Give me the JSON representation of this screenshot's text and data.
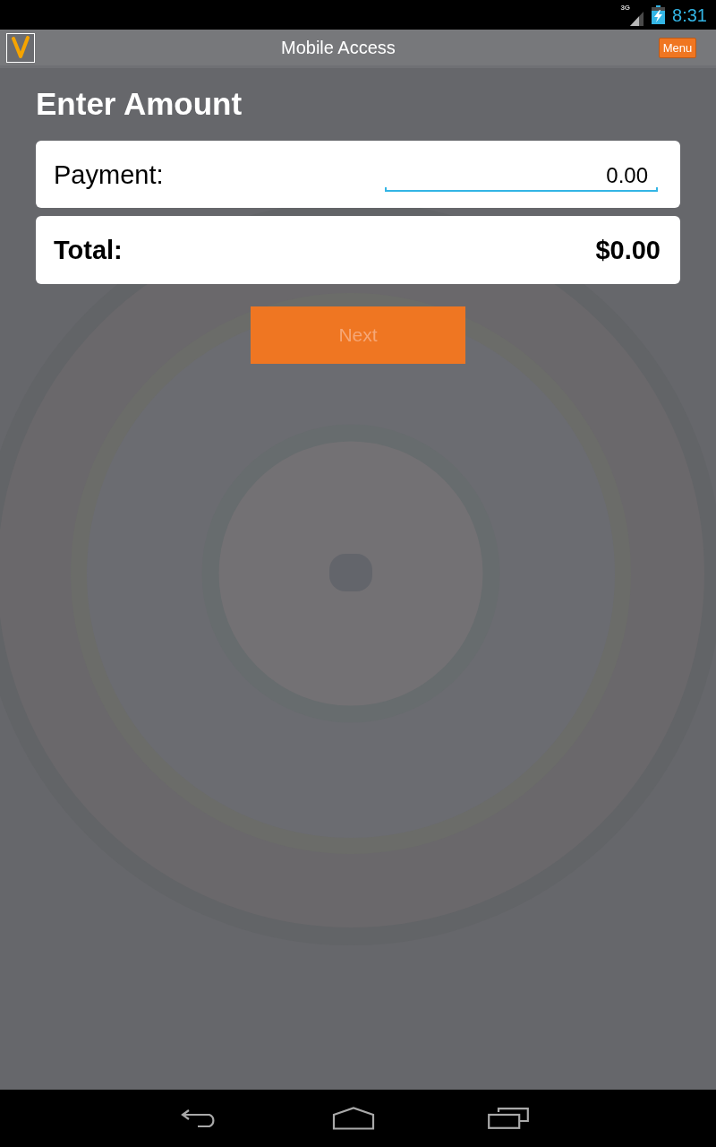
{
  "status_bar": {
    "network": "3G",
    "time": "8:31"
  },
  "app_bar": {
    "title": "Mobile Access",
    "menu_button": "Menu"
  },
  "heading": "Enter Amount",
  "payment": {
    "label": "Payment:",
    "value": "0.00",
    "focused": true
  },
  "total": {
    "label": "Total:",
    "value": "$0.00"
  },
  "next_button": {
    "label": "Next",
    "disabled": true
  }
}
